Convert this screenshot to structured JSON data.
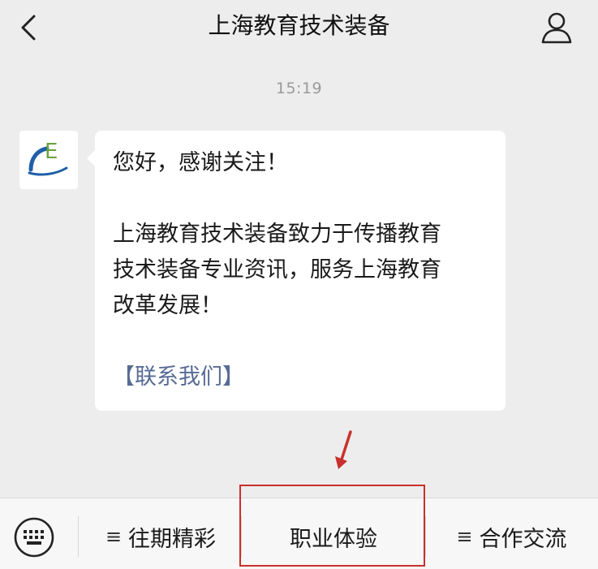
{
  "nav": {
    "title": "上海教育技术装备",
    "back_icon": "chevron-left-icon",
    "profile_icon": "person-icon"
  },
  "chat": {
    "timestamp": "15:19",
    "avatar_letter": "E",
    "lines": [
      "您好，感谢关注！",
      "上海教育技术装备致力于传播教育",
      "技术装备专业资讯，服务上海教育",
      "改革发展！"
    ],
    "link_text": "【联系我们】"
  },
  "menu": {
    "keyboard_icon": "keyboard-icon",
    "items": [
      {
        "glyph": "≡",
        "label": "往期精彩"
      },
      {
        "glyph": "",
        "label": "职业体验"
      },
      {
        "glyph": "≡",
        "label": "合作交流"
      }
    ]
  },
  "colors": {
    "link": "#576b95",
    "highlight": "#c9302c",
    "arrow": "#c9302c",
    "avatar_blue": "#1f5fa8",
    "avatar_green": "#6aa33a"
  }
}
